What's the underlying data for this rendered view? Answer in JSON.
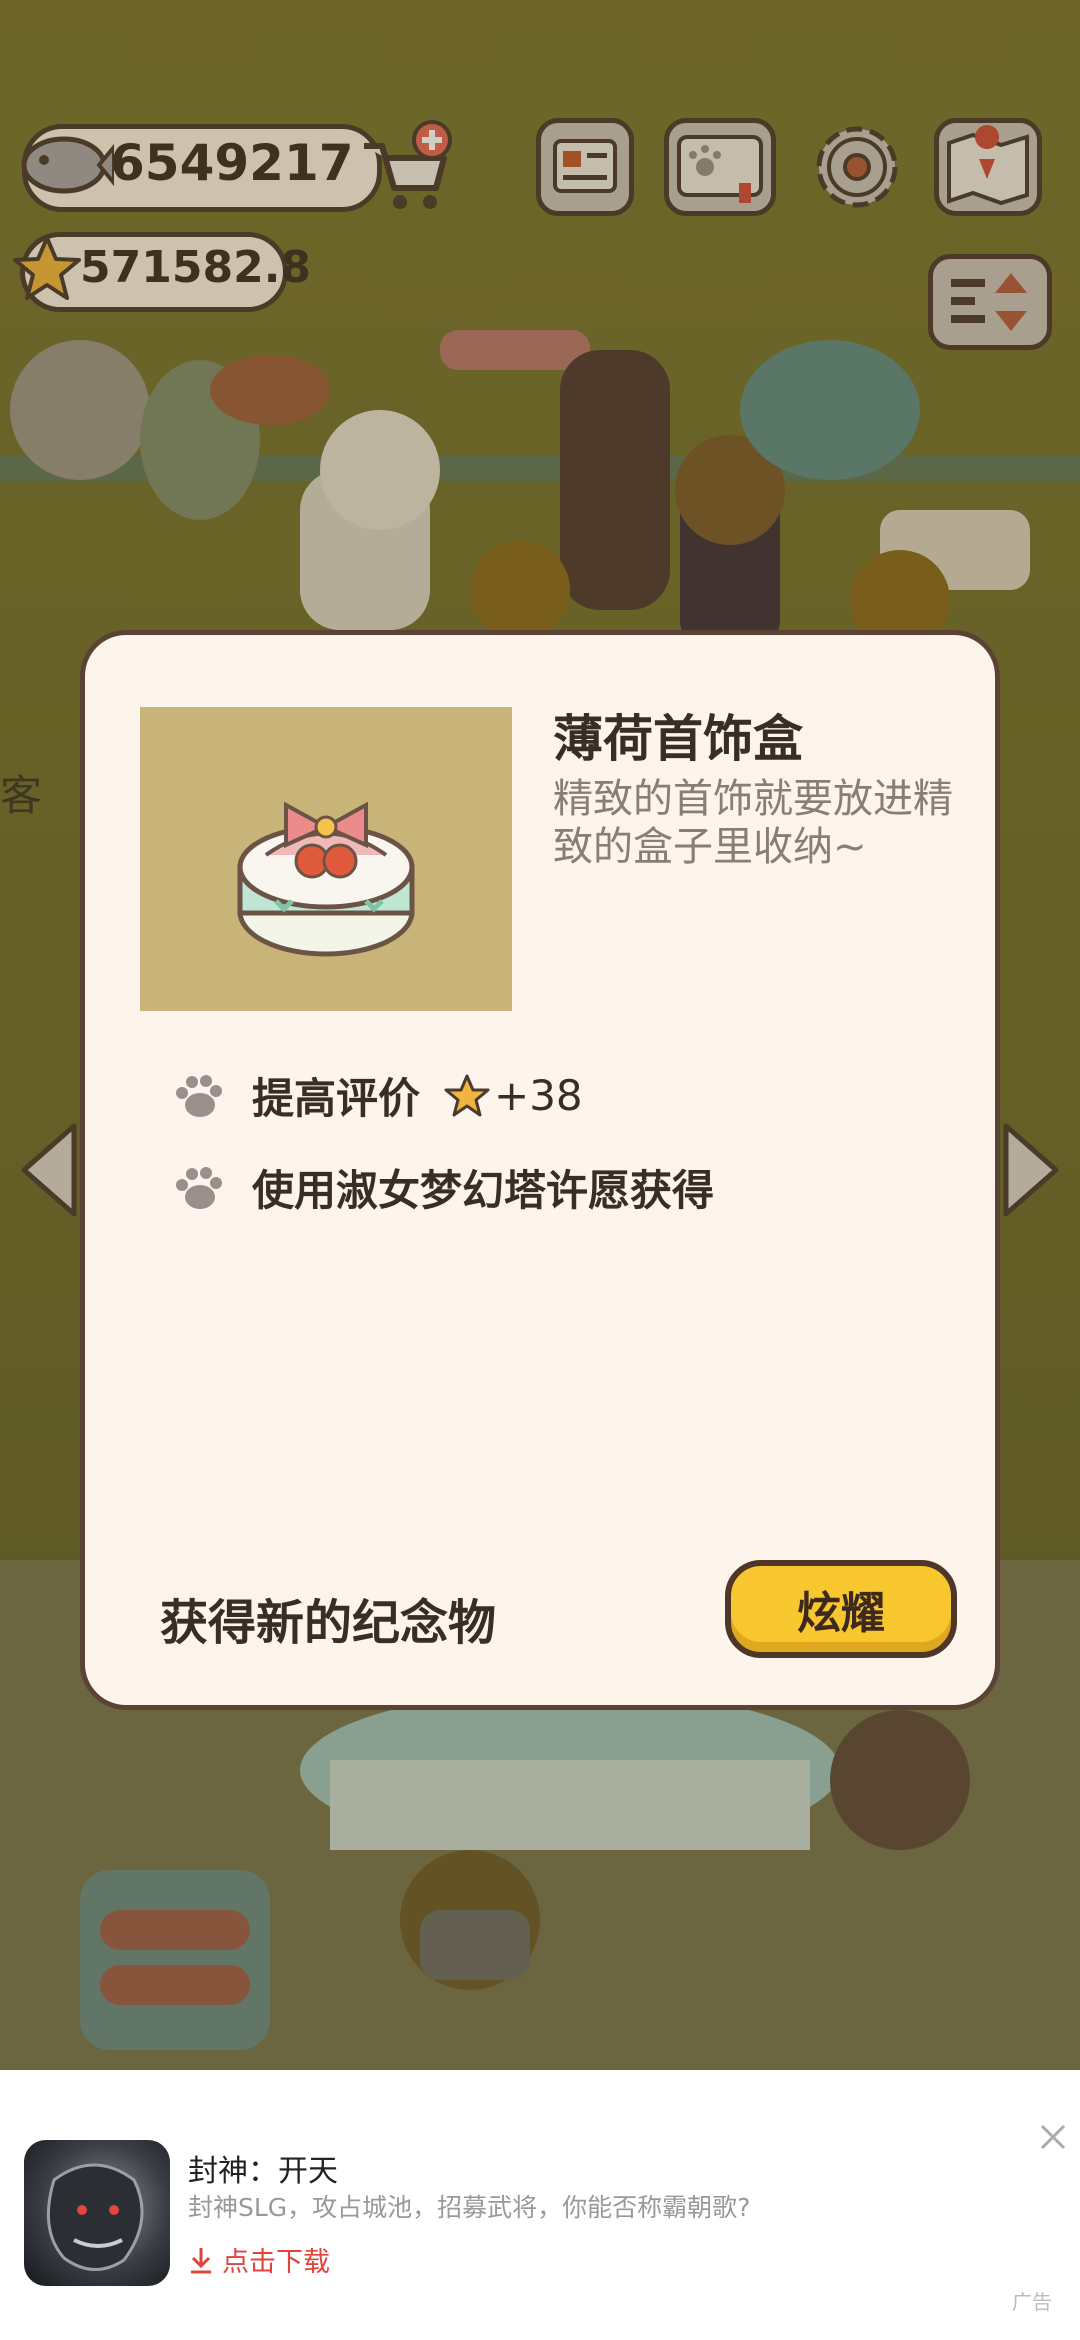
{
  "hud": {
    "fish_count": "6549217",
    "star_rating": "571582.8",
    "icons": [
      "fish-icon",
      "cart-add-icon",
      "news-icon",
      "paw-book-icon",
      "gear-icon",
      "map-icon",
      "sort-icon"
    ]
  },
  "scene": {
    "partial_label": "客"
  },
  "dialog": {
    "item_name": "薄荷首饰盒",
    "item_description": "精致的首饰就要放进精致的盒子里收纳~",
    "attributes": [
      {
        "label": "提高评价",
        "bonus": "+38",
        "icon": "star-icon"
      },
      {
        "label": "使用淑女梦幻塔许愿获得"
      }
    ],
    "footer_label": "获得新的纪念物",
    "show_button": "炫耀"
  },
  "ad": {
    "title": "封神：开天",
    "description": "封神SLG，攻占城池，招募武将，你能否称霸朝歌?",
    "download": "点击下载",
    "tag": "广告"
  },
  "colors": {
    "button_yellow": "#f8c72f",
    "dialog_bg": "#fdf4ec",
    "outline_brown": "#5a4334",
    "ad_red": "#e0443a"
  }
}
